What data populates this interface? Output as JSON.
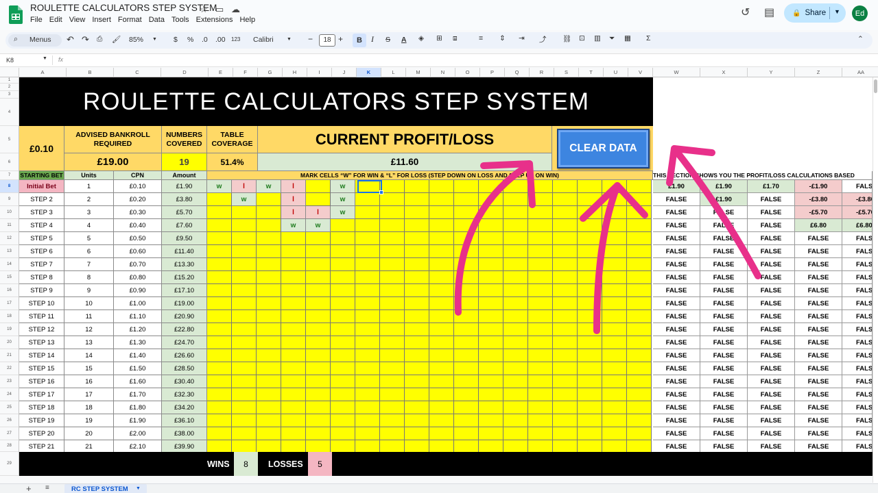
{
  "app": {
    "doc_title": "ROULETTE CALCULATORS STEP SYSTEM",
    "menu": [
      "File",
      "Edit",
      "View",
      "Insert",
      "Format",
      "Data",
      "Tools",
      "Extensions",
      "Help"
    ],
    "share_label": "Share",
    "avatar_initials": "Ed"
  },
  "toolbar": {
    "menus_label": "Menus",
    "zoom": "85%",
    "currency": "$",
    "percent": "%",
    "decimals": ".0",
    "decimals_more": ".00",
    "number_format": "123",
    "font": "Calibri",
    "font_size": "18",
    "bold": "B"
  },
  "formula_bar": {
    "cell_ref": "K8",
    "fx": "fx"
  },
  "columns": [
    "A",
    "B",
    "C",
    "D",
    "E",
    "F",
    "G",
    "H",
    "I",
    "J",
    "K",
    "L",
    "M",
    "N",
    "O",
    "P",
    "Q",
    "R",
    "S",
    "T",
    "U",
    "V",
    "W",
    "X",
    "Y",
    "Z",
    "AA"
  ],
  "sheet": {
    "banner": "ROULETTE CALCULATORS STEP SYSTEM",
    "base_bet": "£0.10",
    "bankroll_label": "ADVISED BANKROLL REQUIRED",
    "bankroll_value": "£19.00",
    "numbers_label": "NUMBERS COVERED",
    "numbers_value": "19",
    "coverage_label": "TABLE COVERAGE",
    "coverage_value": "51.4%",
    "profit_label": "CURRENT PROFIT/LOSS",
    "profit_value": "£11.60",
    "clear_button": "CLEAR DATA",
    "headers": {
      "starting": "STARTING BET",
      "units": "Units",
      "cpn": "CPN",
      "amount": "Amount"
    },
    "mark_instruction": "MARK CELLS “W” FOR WIN & “L” FOR LOSS  (STEP DOWN ON LOSS AND STEP UP ON WIN)",
    "section_note": "THIS SECTION SHOWS YOU THE PROFIT/LOSS CALCULATIONS BASED",
    "rows": [
      {
        "name": "Initial Bet",
        "units": "1",
        "cpn": "£0.10",
        "amount": "£1.90"
      },
      {
        "name": "STEP 2",
        "units": "2",
        "cpn": "£0.20",
        "amount": "£3.80"
      },
      {
        "name": "STEP 3",
        "units": "3",
        "cpn": "£0.30",
        "amount": "£5.70"
      },
      {
        "name": "STEP 4",
        "units": "4",
        "cpn": "£0.40",
        "amount": "£7.60"
      },
      {
        "name": "STEP 5",
        "units": "5",
        "cpn": "£0.50",
        "amount": "£9.50"
      },
      {
        "name": "STEP 6",
        "units": "6",
        "cpn": "£0.60",
        "amount": "£11.40"
      },
      {
        "name": "STEP 7",
        "units": "7",
        "cpn": "£0.70",
        "amount": "£13.30"
      },
      {
        "name": "STEP 8",
        "units": "8",
        "cpn": "£0.80",
        "amount": "£15.20"
      },
      {
        "name": "STEP 9",
        "units": "9",
        "cpn": "£0.90",
        "amount": "£17.10"
      },
      {
        "name": "STEP 10",
        "units": "10",
        "cpn": "£1.00",
        "amount": "£19.00"
      },
      {
        "name": "STEP 11",
        "units": "11",
        "cpn": "£1.10",
        "amount": "£20.90"
      },
      {
        "name": "STEP 12",
        "units": "12",
        "cpn": "£1.20",
        "amount": "£22.80"
      },
      {
        "name": "STEP 13",
        "units": "13",
        "cpn": "£1.30",
        "amount": "£24.70"
      },
      {
        "name": "STEP 14",
        "units": "14",
        "cpn": "£1.40",
        "amount": "£26.60"
      },
      {
        "name": "STEP 15",
        "units": "15",
        "cpn": "£1.50",
        "amount": "£28.50"
      },
      {
        "name": "STEP 16",
        "units": "16",
        "cpn": "£1.60",
        "amount": "£30.40"
      },
      {
        "name": "STEP 17",
        "units": "17",
        "cpn": "£1.70",
        "amount": "£32.30"
      },
      {
        "name": "STEP 18",
        "units": "18",
        "cpn": "£1.80",
        "amount": "£34.20"
      },
      {
        "name": "STEP 19",
        "units": "19",
        "cpn": "£1.90",
        "amount": "£36.10"
      },
      {
        "name": "STEP 20",
        "units": "20",
        "cpn": "£2.00",
        "amount": "£38.00"
      },
      {
        "name": "STEP 21",
        "units": "21",
        "cpn": "£2.10",
        "amount": "£39.90"
      }
    ],
    "marks": [
      {
        "row": 0,
        "col": 0,
        "v": "W"
      },
      {
        "row": 0,
        "col": 1,
        "v": "L"
      },
      {
        "row": 0,
        "col": 2,
        "v": "W"
      },
      {
        "row": 0,
        "col": 3,
        "v": "L"
      },
      {
        "row": 0,
        "col": 5,
        "v": "W"
      },
      {
        "row": 1,
        "col": 1,
        "v": "W"
      },
      {
        "row": 1,
        "col": 3,
        "v": "L"
      },
      {
        "row": 1,
        "col": 5,
        "v": "W"
      },
      {
        "row": 2,
        "col": 3,
        "v": "L"
      },
      {
        "row": 2,
        "col": 4,
        "v": "L"
      },
      {
        "row": 2,
        "col": 5,
        "v": "W"
      },
      {
        "row": 3,
        "col": 3,
        "v": "W"
      },
      {
        "row": 3,
        "col": 4,
        "v": "W"
      }
    ],
    "calc_rows": [
      [
        "£1.90",
        "£1.90",
        "£1.70",
        "-£1.90",
        "FALS"
      ],
      [
        "FALSE",
        "£1.90",
        "FALSE",
        "-£3.80",
        "-£3.80"
      ],
      [
        "FALSE",
        "FALSE",
        "FALSE",
        "-£5.70",
        "-£5.70"
      ],
      [
        "FALSE",
        "FALSE",
        "FALSE",
        "£6.80",
        "£6.80"
      ],
      [
        "FALSE",
        "FALSE",
        "FALSE",
        "FALSE",
        "FALS"
      ]
    ],
    "false_label": "FALSE",
    "false_cut": "FALS",
    "wins_label": "WINS",
    "wins_value": "8",
    "losses_label": "LOSSES",
    "losses_value": "5"
  },
  "sheet_tab": "RC STEP SYSTEM",
  "colors": {
    "yellow": "#ffff00",
    "gold": "#ffd966",
    "green_header": "#6aa84f",
    "pink": "#f4b6c2",
    "light_green": "#d9ead3",
    "arrow": "#e83e8c",
    "button": "#3d85e0"
  }
}
